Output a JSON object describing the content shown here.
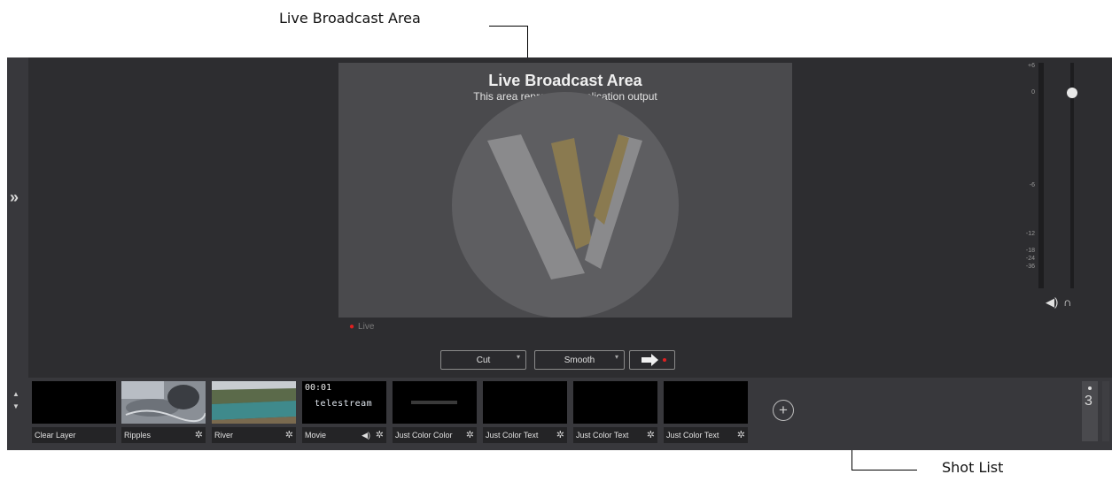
{
  "callouts": {
    "top": "Live Broadcast Area",
    "bottom": "Shot List"
  },
  "preview": {
    "title": "Live Broadcast Area",
    "subtitle": "This area represents application output",
    "live_label": "Live"
  },
  "transitions": {
    "type": "Cut",
    "speed": "Smooth"
  },
  "meter": {
    "labels": [
      "+6",
      "0",
      "-6",
      "-12",
      "-18",
      "-24",
      "-36"
    ]
  },
  "shots": [
    {
      "label": "Clear Layer"
    },
    {
      "label": "Ripples"
    },
    {
      "label": "River"
    },
    {
      "label": "Movie",
      "timecode": "00:01",
      "brand": "telestream"
    },
    {
      "label": "Just Color Color"
    },
    {
      "label": "Just Color Text"
    },
    {
      "label": "Just Color Text"
    },
    {
      "label": "Just Color Text"
    }
  ],
  "layer_number": "3",
  "colors": {
    "live_dot": "#e02020",
    "accent": "#c6a24a"
  }
}
